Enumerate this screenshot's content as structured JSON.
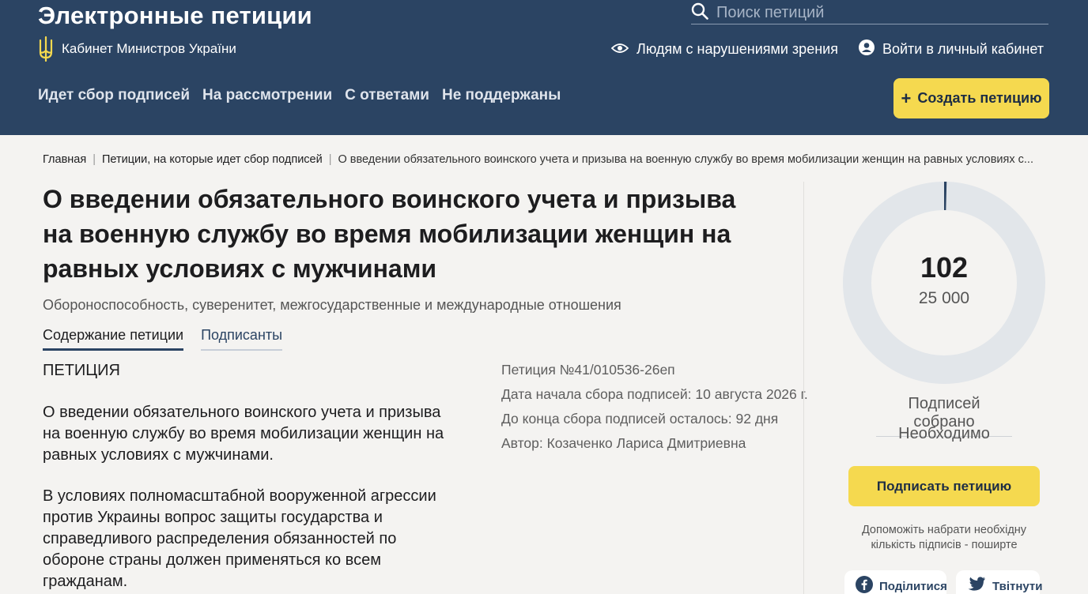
{
  "header": {
    "site_title": "Электронные петиции",
    "org_name": "Кабинет Министров Украïни",
    "search_placeholder": "Поиск петиций",
    "accessibility_link": "Людям с нарушениями зрения",
    "login_link": "Войти в личный кабинет",
    "nav": [
      {
        "label": "Идет сбор подписей"
      },
      {
        "label": "На рассмотрении"
      },
      {
        "label": "С ответами"
      },
      {
        "label": "Не поддержаны"
      }
    ],
    "create_button": "Создать петицию",
    "colors": {
      "bg": "#2b4463",
      "accent": "#f5d94f"
    }
  },
  "breadcrumb": {
    "home": "Главная",
    "section": "Петиции, на которые идет сбор подписей",
    "current": "О введении обязательного воинского учета и призыва на военную службу во время мобилизации женщин на равных условиях с..."
  },
  "petition": {
    "title": "О введении обязательного воинского учета и призыва на военную службу во время мобилизации женщин на равных условиях с мужчинами",
    "category": "Обороноспособность, суверенитет, межгосударственные и международные отношения",
    "tabs": [
      {
        "label": "Содержание петиции"
      },
      {
        "label": "Подписанты"
      }
    ],
    "label": "ПЕТИЦИЯ",
    "paragraphs": [
      "О введении обязательного воинского учета и призыва на военную службу во время мобилизации женщин на равных условиях с мужчинами.",
      "В условиях полномасштабной вооруженной агрессии против Украины вопрос защиты государства и справедливого распределения обязанностей по обороне страны должен применяться ко всем гражданам."
    ],
    "meta": {
      "number": "Петиция №41/010536-26еп",
      "start_date": "Дата начала сбора подписей: 10 августа 2026 г.",
      "days_left": "До конца сбора подписей осталось: 92 дня",
      "author": "Автор: Козаченко Лариса Дмитриевна"
    }
  },
  "signatures": {
    "collected": "102",
    "needed": "25 000",
    "progress_fraction": 0.00408,
    "collected_label": "Подписей собрано",
    "needed_label": "Необходимо",
    "sign_button": "Подписать петицию",
    "share_note": "Допоможіть набрати необхідну кількість підписів - поширте",
    "share_facebook": "Поділитися",
    "share_twitter": "Твітнути"
  }
}
